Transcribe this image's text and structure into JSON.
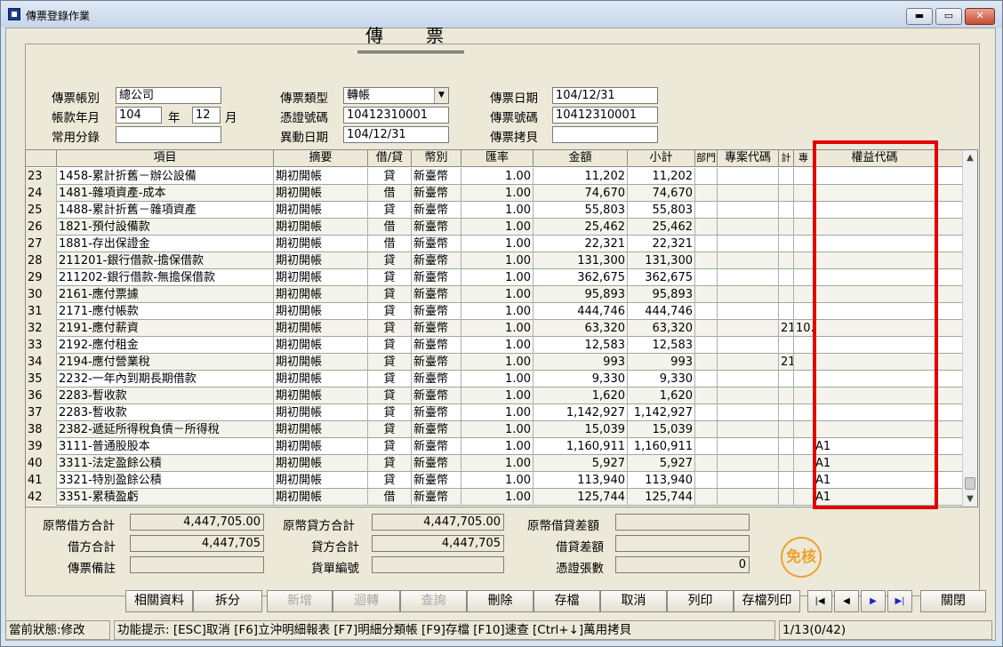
{
  "window": {
    "title": "傳票登錄作業",
    "min": "▬",
    "max": "▭",
    "close": "✕"
  },
  "heading": "傳　票",
  "header": {
    "account_label": "傳票帳別",
    "account_value": "總公司",
    "period_label": "帳款年月",
    "year_value": "104",
    "year_unit": "年",
    "month_value": "12",
    "month_unit": "月",
    "common_label": "常用分錄",
    "common_value": "",
    "type_label": "傳票類型",
    "type_value": "轉帳",
    "voucher_no_label": "憑證號碼",
    "voucher_no_value": "10412310001",
    "change_date_label": "異動日期",
    "change_date_value": "104/12/31",
    "date_label": "傳票日期",
    "date_value": "104/12/31",
    "number_label": "傳票號碼",
    "number_value": "10412310001",
    "copy_label": "傳票拷貝",
    "copy_value": ""
  },
  "grid": {
    "columns": [
      "項目",
      "摘要",
      "借/貸",
      "幣別",
      "匯率",
      "金額",
      "小計",
      "部門",
      "專案代碼",
      "計",
      "專",
      "權益代碼"
    ],
    "rows": [
      {
        "n": "23",
        "item": "1458-累計折舊－辦公設備",
        "memo": "期初開帳",
        "dc": "貸",
        "cur": "新臺幣",
        "rate": "1.00",
        "amt": "11,202",
        "sub": "11,202",
        "x1": "",
        "x2": "",
        "eq": ""
      },
      {
        "n": "24",
        "item": "1481-雜項資產-成本",
        "memo": "期初開帳",
        "dc": "借",
        "cur": "新臺幣",
        "rate": "1.00",
        "amt": "74,670",
        "sub": "74,670",
        "x1": "",
        "x2": "",
        "eq": ""
      },
      {
        "n": "25",
        "item": "1488-累計折舊－雜項資產",
        "memo": "期初開帳",
        "dc": "貸",
        "cur": "新臺幣",
        "rate": "1.00",
        "amt": "55,803",
        "sub": "55,803",
        "x1": "",
        "x2": "",
        "eq": ""
      },
      {
        "n": "26",
        "item": "1821-預付設備款",
        "memo": "期初開帳",
        "dc": "借",
        "cur": "新臺幣",
        "rate": "1.00",
        "amt": "25,462",
        "sub": "25,462",
        "x1": "",
        "x2": "",
        "eq": ""
      },
      {
        "n": "27",
        "item": "1881-存出保證金",
        "memo": "期初開帳",
        "dc": "借",
        "cur": "新臺幣",
        "rate": "1.00",
        "amt": "22,321",
        "sub": "22,321",
        "x1": "",
        "x2": "",
        "eq": ""
      },
      {
        "n": "28",
        "item": "211201-銀行借款-擔保借款",
        "memo": "期初開帳",
        "dc": "貸",
        "cur": "新臺幣",
        "rate": "1.00",
        "amt": "131,300",
        "sub": "131,300",
        "x1": "",
        "x2": "",
        "eq": ""
      },
      {
        "n": "29",
        "item": "211202-銀行借款-無擔保借款",
        "memo": "期初開帳",
        "dc": "貸",
        "cur": "新臺幣",
        "rate": "1.00",
        "amt": "362,675",
        "sub": "362,675",
        "x1": "",
        "x2": "",
        "eq": ""
      },
      {
        "n": "30",
        "item": "2161-應付票據",
        "memo": "期初開帳",
        "dc": "貸",
        "cur": "新臺幣",
        "rate": "1.00",
        "amt": "95,893",
        "sub": "95,893",
        "x1": "",
        "x2": "",
        "eq": ""
      },
      {
        "n": "31",
        "item": "2171-應付帳款",
        "memo": "期初開帳",
        "dc": "貸",
        "cur": "新臺幣",
        "rate": "1.00",
        "amt": "444,746",
        "sub": "444,746",
        "x1": "",
        "x2": "",
        "eq": ""
      },
      {
        "n": "32",
        "item": "2191-應付薪資",
        "memo": "期初開帳",
        "dc": "貸",
        "cur": "新臺幣",
        "rate": "1.00",
        "amt": "63,320",
        "sub": "63,320",
        "x1": "21",
        "x2": "10.",
        "eq": ""
      },
      {
        "n": "33",
        "item": "2192-應付租金",
        "memo": "期初開帳",
        "dc": "貸",
        "cur": "新臺幣",
        "rate": "1.00",
        "amt": "12,583",
        "sub": "12,583",
        "x1": "",
        "x2": "",
        "eq": ""
      },
      {
        "n": "34",
        "item": "2194-應付營業稅",
        "memo": "期初開帳",
        "dc": "貸",
        "cur": "新臺幣",
        "rate": "1.00",
        "amt": "993",
        "sub": "993",
        "x1": "21",
        "x2": "",
        "eq": ""
      },
      {
        "n": "35",
        "item": "2232-一年內到期長期借款",
        "memo": "期初開帳",
        "dc": "貸",
        "cur": "新臺幣",
        "rate": "1.00",
        "amt": "9,330",
        "sub": "9,330",
        "x1": "",
        "x2": "",
        "eq": ""
      },
      {
        "n": "36",
        "item": "2283-暫收款",
        "memo": "期初開帳",
        "dc": "貸",
        "cur": "新臺幣",
        "rate": "1.00",
        "amt": "1,620",
        "sub": "1,620",
        "x1": "",
        "x2": "",
        "eq": ""
      },
      {
        "n": "37",
        "item": "2283-暫收款",
        "memo": "期初開帳",
        "dc": "貸",
        "cur": "新臺幣",
        "rate": "1.00",
        "amt": "1,142,927",
        "sub": "1,142,927",
        "x1": "",
        "x2": "",
        "eq": ""
      },
      {
        "n": "38",
        "item": "2382-遞延所得稅負債－所得稅",
        "memo": "期初開帳",
        "dc": "貸",
        "cur": "新臺幣",
        "rate": "1.00",
        "amt": "15,039",
        "sub": "15,039",
        "x1": "",
        "x2": "",
        "eq": ""
      },
      {
        "n": "39",
        "item": "3111-普通股股本",
        "memo": "期初開帳",
        "dc": "貸",
        "cur": "新臺幣",
        "rate": "1.00",
        "amt": "1,160,911",
        "sub": "1,160,911",
        "x1": "",
        "x2": "",
        "eq": "A1"
      },
      {
        "n": "40",
        "item": "3311-法定盈餘公積",
        "memo": "期初開帳",
        "dc": "貸",
        "cur": "新臺幣",
        "rate": "1.00",
        "amt": "5,927",
        "sub": "5,927",
        "x1": "",
        "x2": "",
        "eq": "A1"
      },
      {
        "n": "41",
        "item": "3321-特別盈餘公積",
        "memo": "期初開帳",
        "dc": "貸",
        "cur": "新臺幣",
        "rate": "1.00",
        "amt": "113,940",
        "sub": "113,940",
        "x1": "",
        "x2": "",
        "eq": "A1"
      },
      {
        "n": "42",
        "item": "3351-累積盈虧",
        "memo": "期初開帳",
        "dc": "借",
        "cur": "新臺幣",
        "rate": "1.00",
        "amt": "125,744",
        "sub": "125,744",
        "x1": "",
        "x2": "",
        "eq": "A1"
      }
    ]
  },
  "totals": {
    "orig_debit_label": "原幣借方合計",
    "orig_debit_value": "4,447,705.00",
    "orig_credit_label": "原幣貸方合計",
    "orig_credit_value": "4,447,705.00",
    "orig_diff_label": "原幣借貸差額",
    "orig_diff_value": "",
    "debit_label": "借方合計",
    "debit_value": "4,447,705",
    "credit_label": "貸方合計",
    "credit_value": "4,447,705",
    "diff_label": "借貸差額",
    "diff_value": "",
    "memo_label": "傳票備註",
    "memo_value": "",
    "bill_label": "貨單編號",
    "bill_value": "",
    "count_label": "憑證張數",
    "count_value": "0",
    "stamp": "免核"
  },
  "buttons": {
    "related": "相關資料",
    "split": "拆分",
    "add": "新增",
    "reverse": "迴轉",
    "query": "查詢",
    "delete": "刪除",
    "save": "存檔",
    "cancel": "取消",
    "print": "列印",
    "save_print": "存檔列印",
    "first": "|◀",
    "prev": "◀",
    "next": "▶",
    "last": "▶|",
    "close": "關閉"
  },
  "status": {
    "state": "當前狀態:修改",
    "hint": "功能提示: [ESC]取消 [F6]立沖明細報表 [F7]明細分類帳 [F9]存檔 [F10]速查 [Ctrl+↓]萬用拷貝",
    "page": "1/13(0/42)"
  }
}
